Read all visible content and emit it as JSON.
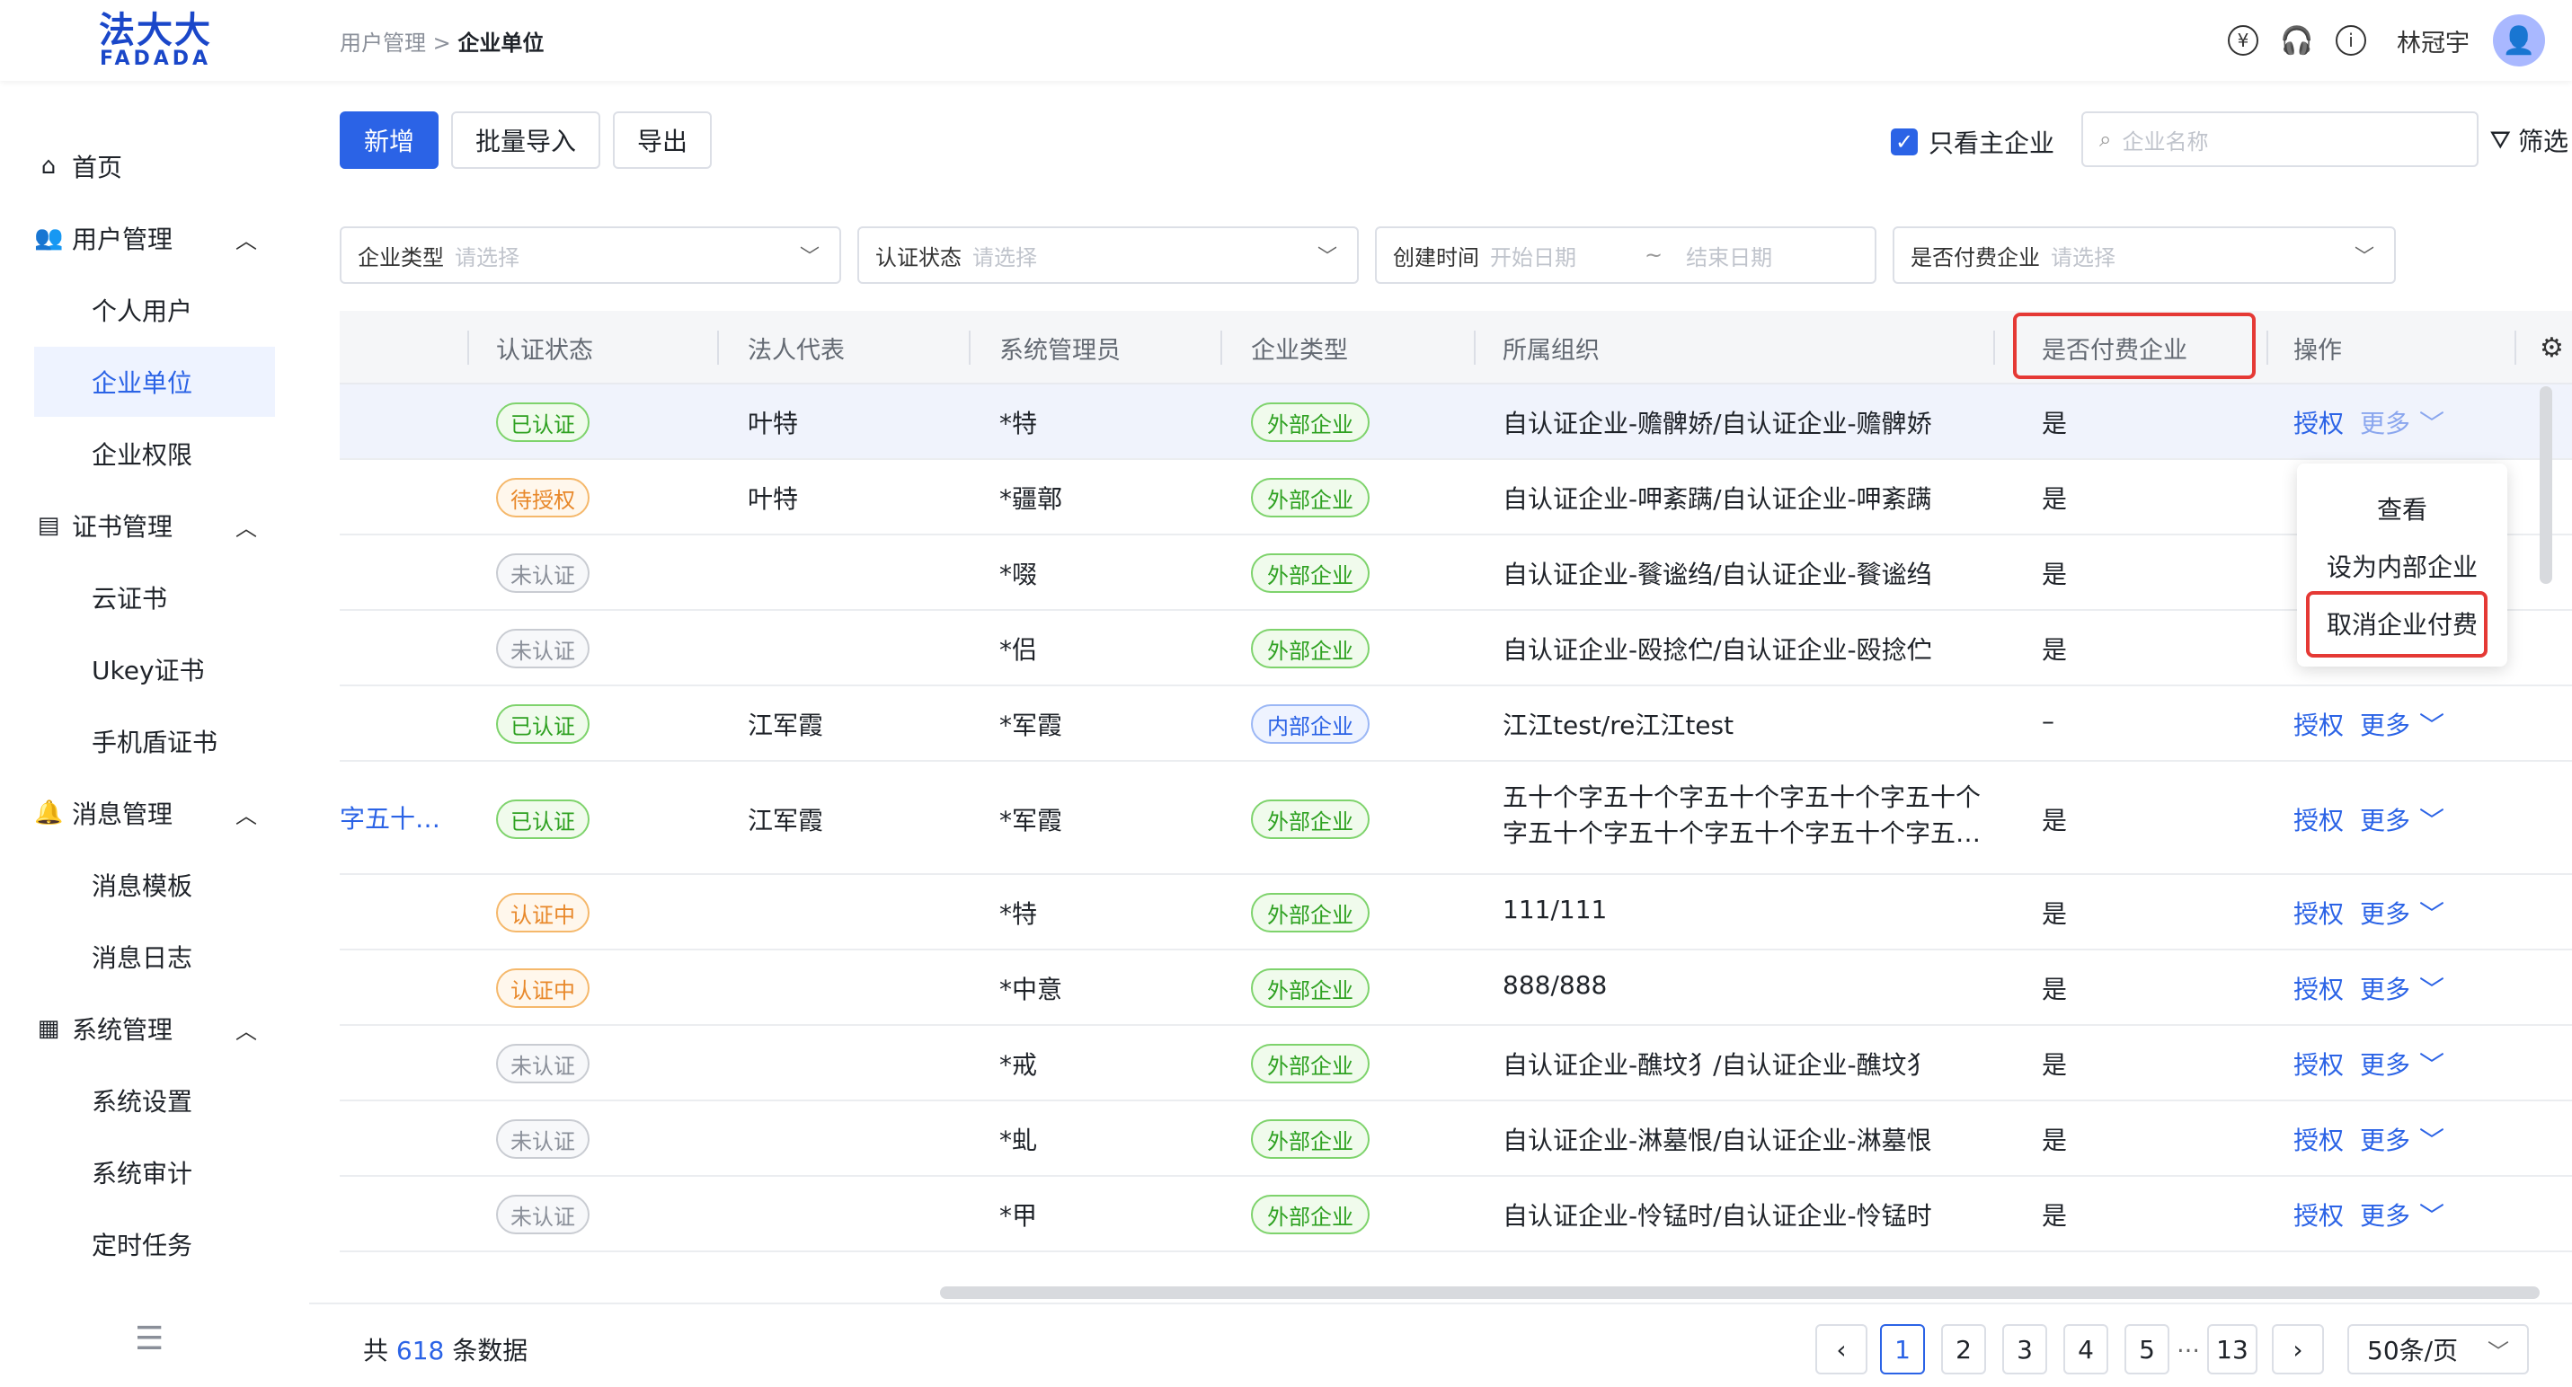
{
  "brand": {
    "name_cn": "法大大",
    "name_en": "FADADA"
  },
  "breadcrumb": {
    "parent": "用户管理",
    "separator": ">",
    "current": "企业单位"
  },
  "header": {
    "username": "林冠宇",
    "icons": [
      "yen-icon",
      "headset-icon",
      "info-icon"
    ]
  },
  "sidebar": {
    "items": [
      {
        "label": "首页",
        "icon": "home-icon"
      },
      {
        "label": "用户管理",
        "icon": "users-icon",
        "expanded": true
      },
      {
        "label": "个人用户"
      },
      {
        "label": "企业单位",
        "active": true
      },
      {
        "label": "企业权限"
      },
      {
        "label": "证书管理",
        "icon": "certificate-icon",
        "expanded": true
      },
      {
        "label": "云证书"
      },
      {
        "label": "Ukey证书"
      },
      {
        "label": "手机盾证书"
      },
      {
        "label": "消息管理",
        "icon": "bell-icon",
        "expanded": true
      },
      {
        "label": "消息模板"
      },
      {
        "label": "消息日志"
      },
      {
        "label": "系统管理",
        "icon": "system-icon",
        "expanded": true
      },
      {
        "label": "系统设置"
      },
      {
        "label": "系统审计"
      },
      {
        "label": "定时任务"
      }
    ]
  },
  "toolbar": {
    "add": "新增",
    "batch_import": "批量导入",
    "export": "导出",
    "only_main": "只看主企业",
    "only_main_checked": true,
    "search_placeholder": "企业名称",
    "filter": "筛选"
  },
  "filters": {
    "type_label": "企业类型",
    "type_ph": "请选择",
    "status_label": "认证状态",
    "status_ph": "请选择",
    "created_label": "创建时间",
    "start_ph": "开始日期",
    "tilde": "~",
    "end_ph": "结束日期",
    "paid_label": "是否付费企业",
    "paid_ph": "请选择"
  },
  "table": {
    "columns": [
      "认证状态",
      "法人代表",
      "系统管理员",
      "企业类型",
      "所属组织",
      "是否付费企业",
      "操作"
    ],
    "rows": [
      {
        "name": "",
        "status": "已认证",
        "status_kind": "ok",
        "legal": "叶特",
        "admin": "*特",
        "type": "外部企业",
        "org": "自认证企业-赡髀娇/自认证企业-赡髀娇",
        "paid": "是",
        "auth": "授权",
        "more": "更多"
      },
      {
        "name": "",
        "status": "待授权",
        "status_kind": "wait",
        "legal": "叶特",
        "admin": "*疆鄣",
        "type": "外部企业",
        "org": "自认证企业-呷紊蹒/自认证企业-呷紊蹒",
        "paid": "是",
        "auth": "",
        "more": ""
      },
      {
        "name": "",
        "status": "未认证",
        "status_kind": "no",
        "legal": "",
        "admin": "*啜",
        "type": "外部企业",
        "org": "自认证企业-餮谧绉/自认证企业-餮谧绉",
        "paid": "是",
        "auth": "",
        "more": ""
      },
      {
        "name": "",
        "status": "未认证",
        "status_kind": "no",
        "legal": "",
        "admin": "*侣",
        "type": "外部企业",
        "org": "自认证企业-殴捻伫/自认证企业-殴捻伫",
        "paid": "是",
        "auth": "",
        "more": ""
      },
      {
        "name": "",
        "status": "已认证",
        "status_kind": "ok",
        "legal": "江军霞",
        "admin": "*军霞",
        "type": "内部企业",
        "org": "江江test/re江江test",
        "paid": "–",
        "auth": "授权",
        "more": "更多"
      },
      {
        "name": "字五十…",
        "status": "已认证",
        "status_kind": "ok",
        "legal": "江军霞",
        "admin": "*军霞",
        "type": "外部企业",
        "org": "五十个字五十个字五十个字五十个字五十个",
        "org2": "字五十个字五十个字五十个字五十个字五…",
        "paid": "是",
        "auth": "授权",
        "more": "更多"
      },
      {
        "name": "",
        "status": "认证中",
        "status_kind": "wait",
        "legal": "",
        "admin": "*特",
        "type": "外部企业",
        "org": "111/111",
        "paid": "是",
        "auth": "授权",
        "more": "更多"
      },
      {
        "name": "",
        "status": "认证中",
        "status_kind": "wait",
        "legal": "",
        "admin": "*中意",
        "type": "外部企业",
        "org": "888/888",
        "paid": "是",
        "auth": "授权",
        "more": "更多"
      },
      {
        "name": "",
        "status": "未认证",
        "status_kind": "no",
        "legal": "",
        "admin": "*戒",
        "type": "外部企业",
        "org": "自认证企业-醮坟犭/自认证企业-醮坟犭",
        "paid": "是",
        "auth": "授权",
        "more": "更多"
      },
      {
        "name": "",
        "status": "未认证",
        "status_kind": "no",
        "legal": "",
        "admin": "*虬",
        "type": "外部企业",
        "org": "自认证企业-淋墓恨/自认证企业-淋墓恨",
        "paid": "是",
        "auth": "授权",
        "more": "更多"
      },
      {
        "name": "",
        "status": "未认证",
        "status_kind": "no",
        "legal": "",
        "admin": "*甲",
        "type": "外部企业",
        "org": "自认证企业-怜锰时/自认证企业-怜锰时",
        "paid": "是",
        "auth": "授权",
        "more": "更多"
      }
    ]
  },
  "dropdown": {
    "items": [
      "查看",
      "设为内部企业",
      "取消企业付费"
    ]
  },
  "pagination": {
    "total_prefix": "共",
    "total": "618",
    "total_suffix": "条数据",
    "pages": [
      "1",
      "2",
      "3",
      "4",
      "5"
    ],
    "ellipsis": "…",
    "last": "13",
    "current": "1",
    "page_size": "50条/页"
  },
  "colors": {
    "primary": "#2b63e6",
    "highlight_border": "#e53935",
    "success": "#2ea121",
    "warning": "#e8882a"
  }
}
